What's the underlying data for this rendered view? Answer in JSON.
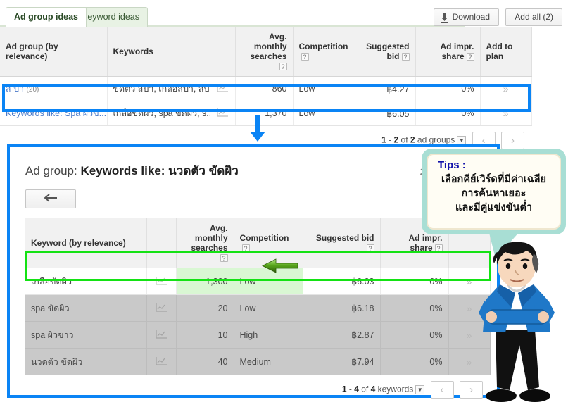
{
  "tabs": [
    {
      "label": "Ad group ideas",
      "active": true
    },
    {
      "label": "Keyword ideas",
      "active": false
    }
  ],
  "toolbar": {
    "download_label": "Download",
    "download_icon": "download-icon",
    "add_all_label": "Add all (2)"
  },
  "ad_group_table": {
    "columns": [
      "Ad group (by relevance)",
      "Keywords",
      "",
      "Avg. monthly searches",
      "Competition",
      "Suggested bid",
      "Ad impr. share",
      "Add to plan"
    ],
    "rows": [
      {
        "ad_group": "ส ปา",
        "ad_group_count": "(20)",
        "keywords": "ขัดตัว สปา, เกลือสปา, สป...",
        "searches": "860",
        "competition": "Low",
        "suggested_bid": "฿4.27",
        "impr_share": "0%",
        "add": "»",
        "highlighted": false
      },
      {
        "ad_group": "Keywords like: Spa ผิวข...",
        "ad_group_count": "",
        "keywords": "เกลือขัดผิว, spa ขัดผิว, s...",
        "searches": "1,370",
        "competition": "Low",
        "suggested_bid": "฿6.05",
        "impr_share": "0%",
        "add": "»",
        "highlighted": true
      }
    ],
    "pager": {
      "range_start": "1",
      "dash": " - ",
      "range_end": "2",
      "of_text": " of ",
      "total": "2",
      "unit": " ad groups",
      "prev": "‹",
      "next": "›"
    }
  },
  "detail_panel": {
    "title_prefix": "Ad group: ",
    "title_value": "Keywords like: นวดตัว ขัดผิว",
    "count_text": "2 of 2 ad group id",
    "back_icon": "back-arrow-icon",
    "keyword_table": {
      "columns": [
        "Keyword (by relevance)",
        "",
        "Avg. monthly searches",
        "Competition",
        "Suggested bid",
        "Ad impr. share",
        "Add to plan"
      ],
      "rows": [
        {
          "keyword": "เกลือขัดผิว",
          "searches": "1,300",
          "competition": "Low",
          "suggested_bid": "฿6.03",
          "impr_share": "0%",
          "add": "»",
          "highlighted": true
        },
        {
          "keyword": "spa ขัดผิว",
          "searches": "20",
          "competition": "Low",
          "suggested_bid": "฿6.18",
          "impr_share": "0%",
          "add": "»",
          "highlighted": false
        },
        {
          "keyword": "spa ผิวขาว",
          "searches": "10",
          "competition": "High",
          "suggested_bid": "฿2.87",
          "impr_share": "0%",
          "add": "»",
          "highlighted": false
        },
        {
          "keyword": "นวดตัว ขัดผิว",
          "searches": "40",
          "competition": "Medium",
          "suggested_bid": "฿7.94",
          "impr_share": "0%",
          "add": "»",
          "highlighted": false
        }
      ],
      "pager": {
        "range_start": "1",
        "dash": " - ",
        "range_end": "4",
        "of_text": " of ",
        "total": "4",
        "unit": " keywords",
        "prev": "‹",
        "next": "›"
      }
    }
  },
  "tips": {
    "title": "Tips :",
    "line1": "เลือกคีย์เวิร์ดที่มีค่าเฉลีย",
    "line2": "การค้นหาเยอะ",
    "line3": "และมีคู่แข่งขันต่ำ"
  },
  "annotations": {
    "blue_arrow": "blue-down-arrow",
    "green_arrow": "green-left-arrow",
    "mascot": "mascot-man-illustration"
  },
  "colors": {
    "highlight_blue": "#0a84f5",
    "highlight_green": "#14e214",
    "tips_bubble": "#a8ded4",
    "tab_active": "#ffffff"
  }
}
